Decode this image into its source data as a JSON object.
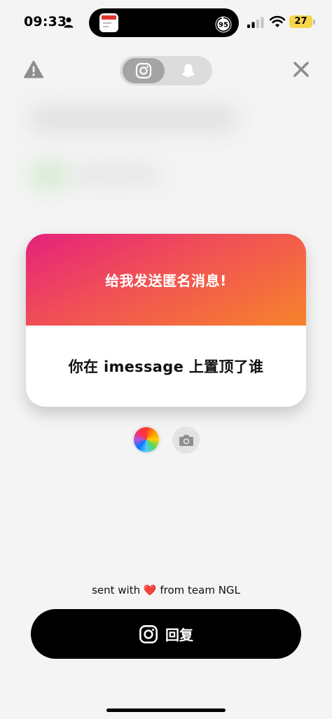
{
  "status_bar": {
    "time": "09:33",
    "island_progress": "95",
    "battery": "27"
  },
  "toggle": {
    "active": "instagram"
  },
  "card": {
    "title": "给我发送匿名消息!",
    "message": "你在 imessage 上置顶了谁",
    "gradient_colors": [
      "#e5217d",
      "#f04c59",
      "#f7832b"
    ]
  },
  "footer": {
    "sent_prefix": "sent with",
    "heart": "❤️",
    "sent_suffix": "from team NGL",
    "reply_label": "回复"
  },
  "icons": [
    "person-icon",
    "signal-icon",
    "wifi-icon",
    "warning-icon",
    "instagram-icon",
    "snapchat-icon",
    "close-icon",
    "color-wheel-icon",
    "camera-icon"
  ]
}
